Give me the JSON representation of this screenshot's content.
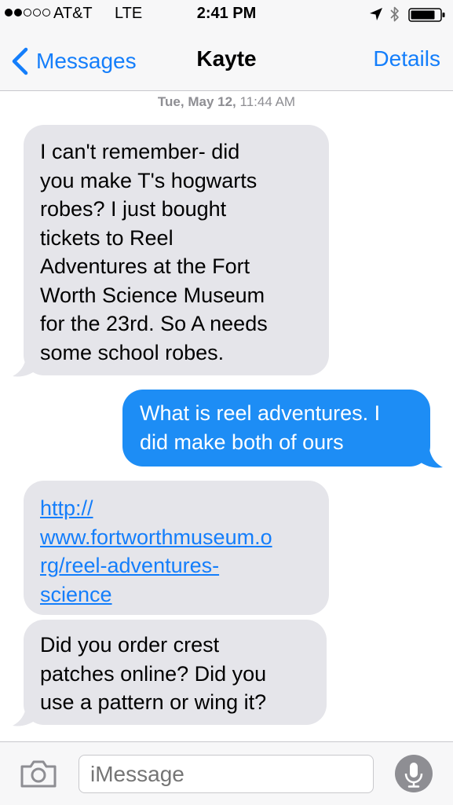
{
  "status_bar": {
    "carrier": "AT&T",
    "network": "LTE",
    "time": "2:41 PM",
    "signal_bars_filled": 2,
    "signal_bars_total": 5,
    "icons": [
      "location-arrow-icon",
      "bluetooth-icon",
      "battery-icon"
    ]
  },
  "nav": {
    "back_label": "Messages",
    "title": "Kayte",
    "details_label": "Details"
  },
  "conversation": {
    "timestamp_day": "Tue, May 12,",
    "timestamp_time": "11:44 AM",
    "messages": [
      {
        "direction": "incoming",
        "lines": [
          "I can't remember- did",
          "you make T's hogwarts",
          "robes? I just bought",
          "tickets to Reel",
          "Adventures at the Fort",
          "Worth Science Museum",
          "for the 23rd. So A needs",
          "some school robes."
        ]
      },
      {
        "direction": "outgoing",
        "lines": [
          "What is reel adventures. I",
          "did make both of ours"
        ]
      },
      {
        "direction": "incoming",
        "link_lines": [
          "http://",
          "www.fortworthmuseum.o",
          "rg/reel-adventures-",
          "science"
        ]
      },
      {
        "direction": "incoming",
        "lines": [
          "Did you order crest",
          "patches online? Did you",
          "use a pattern or wing it?"
        ]
      }
    ]
  },
  "input_bar": {
    "placeholder": "iMessage"
  },
  "colors": {
    "accent": "#147efb",
    "outgoing_bubble": "#1d8df5",
    "incoming_bubble": "#e5e5ea",
    "bar_background": "#f7f7f8",
    "timestamp_text": "#8e8e93"
  }
}
